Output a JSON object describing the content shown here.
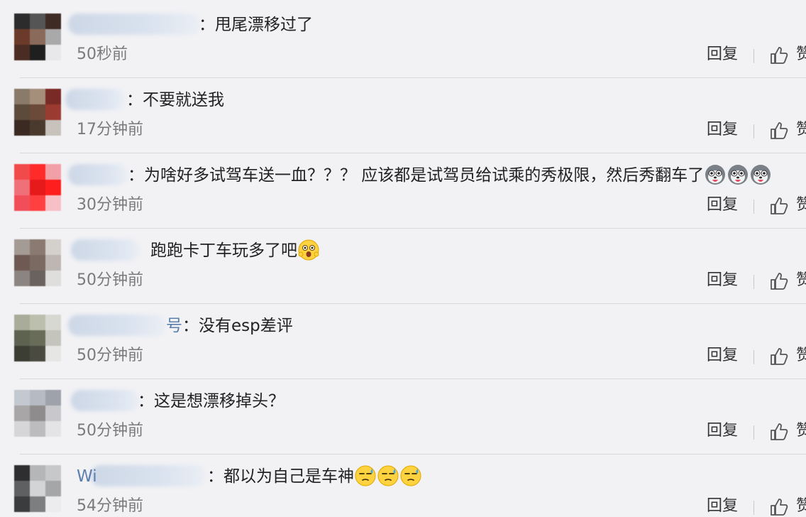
{
  "comments": [
    {
      "name_fragment": "",
      "text": "：甩尾漂移过了",
      "time": "50秒前",
      "reply": "回复",
      "like": "赞",
      "emojis": [],
      "avatar_colors": [
        "#2c2c2c",
        "#555555",
        "#3d2b24",
        "#6b3a2a",
        "#8a6b5b",
        "#a9a9a9",
        "#4a2c22",
        "#1f1f1f",
        "#e8e8ea"
      ]
    },
    {
      "name_fragment": "",
      "text": "：不要就送我",
      "time": "17分钟前",
      "reply": "回复",
      "like": "赞",
      "emojis": [],
      "avatar_colors": [
        "#8a7a6a",
        "#a58f7b",
        "#7a2a26",
        "#5c4a3a",
        "#6b4a3a",
        "#9a3a30",
        "#3a2a22",
        "#4a3a2e",
        "#c8c2bc"
      ]
    },
    {
      "name_fragment": "",
      "text": "：为啥好多试驾车送一血？？？ 应该都是试驾员给试乘的秀极限，然后秀翻车了",
      "time": "30分钟前",
      "reply": "回复",
      "like": "赞",
      "emojis": [
        "husky-face",
        "husky-face",
        "husky-face"
      ],
      "avatar_colors": [
        "#f24a4a",
        "#ff2a2a",
        "#f2a0a8",
        "#f0707a",
        "#e61a1a",
        "#ff1e1e",
        "#f24e5a",
        "#ff4040",
        "#f7c0c6"
      ]
    },
    {
      "name_fragment": "",
      "text": "跑跑卡丁车玩多了吧",
      "time": "50分钟前",
      "reply": "回复",
      "like": "赞",
      "emojis": [
        "shocked-face"
      ],
      "avatar_colors": [
        "#a49b95",
        "#8a7a72",
        "#d4d0cc",
        "#6e5a52",
        "#7a6a62",
        "#bdb6b2",
        "#8c8480",
        "#6a625e",
        "#e0dedc"
      ]
    },
    {
      "name_fragment": "号",
      "text": "：没有esp差评",
      "time": "50分钟前",
      "reply": "回复",
      "like": "赞",
      "emojis": [],
      "avatar_colors": [
        "#a8ac98",
        "#bcbfae",
        "#d8d8d2",
        "#5e6250",
        "#6a6c5a",
        "#c4c4bc",
        "#3c3e34",
        "#4a4a40",
        "#e6e6e4"
      ]
    },
    {
      "name_fragment": "",
      "text": "：这是想漂移掉头？",
      "time": "50分钟前",
      "reply": "回复",
      "like": "赞",
      "emojis": [],
      "avatar_colors": [
        "#c4c8d0",
        "#b6bac2",
        "#9ea2aa",
        "#a8a6a6",
        "#8e8c8c",
        "#c8c8cc",
        "#d6d6d8",
        "#bcbcbe",
        "#e4e4e6"
      ]
    },
    {
      "name_fragment": "Wi",
      "text": "：都以为自己是车神",
      "time": "54分钟前",
      "reply": "回复",
      "like": "赞",
      "emojis": [
        "sweat-face",
        "sweat-face",
        "sweat-face"
      ],
      "avatar_colors": [
        "#2e2e30",
        "#b4b6b8",
        "#c6c8ca",
        "#5e6062",
        "#d2d4d6",
        "#a4a6a8",
        "#3a3c3e",
        "#7c7e80",
        "#ececee"
      ]
    }
  ]
}
